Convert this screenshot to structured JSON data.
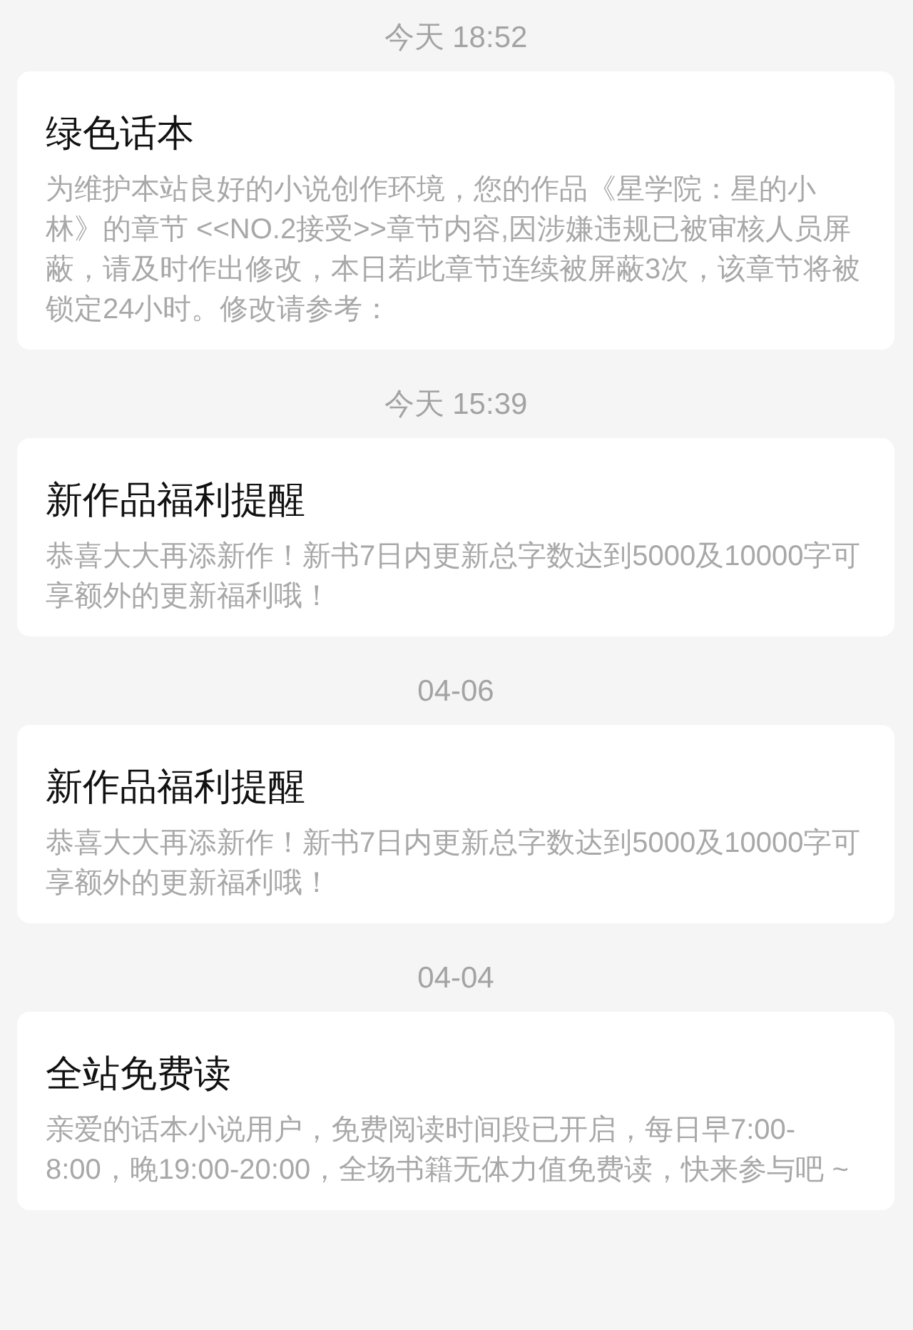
{
  "messages": [
    {
      "time": "今天 18:52",
      "title": "绿色话本",
      "body": "为维护本站良好的小说创作环境，您的作品《星学院：星的小林》的章节 <<NO.2接受>>章节内容,因涉嫌违规已被审核人员屏蔽，请及时作出修改，本日若此章节连续被屏蔽3次，该章节将被锁定24小时。修改请参考："
    },
    {
      "time": "今天 15:39",
      "title": "新作品福利提醒",
      "body": "恭喜大大再添新作！新书7日内更新总字数达到5000及10000字可享额外的更新福利哦！"
    },
    {
      "time": "04-06",
      "title": "新作品福利提醒",
      "body": "恭喜大大再添新作！新书7日内更新总字数达到5000及10000字可享额外的更新福利哦！"
    },
    {
      "time": "04-04",
      "title": "全站免费读",
      "body": "亲爱的话本小说用户，免费阅读时间段已开启，每日早7:00-8:00，晚19:00-20:00，全场书籍无体力值免费读，快来参与吧 ~"
    }
  ]
}
